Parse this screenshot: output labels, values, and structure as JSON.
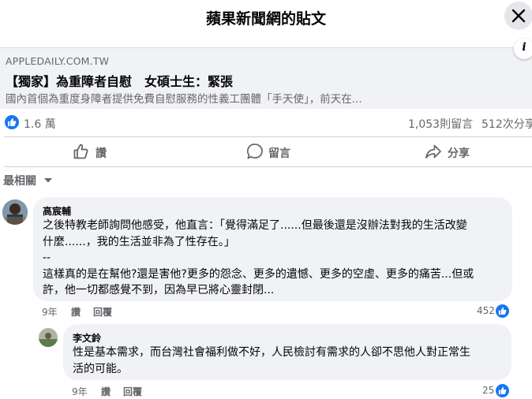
{
  "dialog": {
    "title": "蘋果新聞網的貼文"
  },
  "link_preview": {
    "domain": "APPLEDAILY.COM.TW",
    "title": "【獨家】為重障者自慰　女碩士生：緊張",
    "description": "國內首個為重度身障者提供免費自慰服務的性義工團體「手天使」，前天在..."
  },
  "stats": {
    "reactions": "1.6 萬",
    "comments": "1,053則留言",
    "shares": "512次分享"
  },
  "actions": {
    "like": "讚",
    "comment": "留言",
    "share": "分享"
  },
  "comments_sort": "最相關",
  "comments": [
    {
      "author": "高宸輔",
      "lines": [
        "之後特教老師詢問他感受，他直言：「覺得滿足了......但最後還是沒辦法對我的生活改變",
        "什麼......，我的生活並非為了性存在。」",
        "--",
        "這樣真的是在幫他?還是害他?更多的怨念、更多的遺憾、更多的空虛、更多的痛苦...但或",
        "許，他一切都感覺不到，因為早已將心靈封閉..."
      ],
      "time": "9年",
      "like_label": "讚",
      "reply_label": "回覆",
      "reaction_count": "452"
    },
    {
      "author": "李文鈴",
      "lines": [
        "性是基本需求，而台灣社會福利做不好，人民檢討有需求的人卻不思他人對正常生",
        "活的可能。"
      ],
      "time": "9年",
      "like_label": "讚",
      "reply_label": "回覆",
      "reaction_count": "25"
    }
  ],
  "colors": {
    "brand_blue": "#1877f2",
    "muted_text": "#65676b",
    "bubble_bg": "#f0f2f5"
  },
  "icons": [
    "close-icon",
    "info-icon",
    "like-icon",
    "comment-icon",
    "share-icon",
    "chevron-down-icon"
  ]
}
